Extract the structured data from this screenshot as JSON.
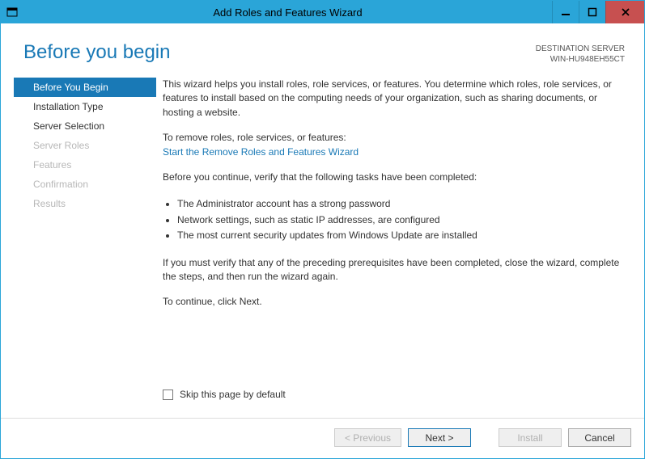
{
  "window": {
    "title": "Add Roles and Features Wizard"
  },
  "header": {
    "page_title": "Before you begin",
    "dest_label": "DESTINATION SERVER",
    "dest_value": "WIN-HU948EH55CT"
  },
  "nav": {
    "items": [
      {
        "label": "Before You Begin",
        "state": "selected"
      },
      {
        "label": "Installation Type",
        "state": "enabled"
      },
      {
        "label": "Server Selection",
        "state": "enabled"
      },
      {
        "label": "Server Roles",
        "state": "disabled"
      },
      {
        "label": "Features",
        "state": "disabled"
      },
      {
        "label": "Confirmation",
        "state": "disabled"
      },
      {
        "label": "Results",
        "state": "disabled"
      }
    ]
  },
  "content": {
    "intro": "This wizard helps you install roles, role services, or features. You determine which roles, role services, or features to install based on the computing needs of your organization, such as sharing documents, or hosting a website.",
    "remove_lead": "To remove roles, role services, or features:",
    "remove_link": "Start the Remove Roles and Features Wizard",
    "verify_lead": "Before you continue, verify that the following tasks have been completed:",
    "bullets": [
      "The Administrator account has a strong password",
      "Network settings, such as static IP addresses, are configured",
      "The most current security updates from Windows Update are installed"
    ],
    "close_note": "If you must verify that any of the preceding prerequisites have been completed, close the wizard, complete the steps, and then run the wizard again.",
    "continue_note": "To continue, click Next.",
    "skip_label": "Skip this page by default"
  },
  "footer": {
    "previous": "< Previous",
    "next": "Next >",
    "install": "Install",
    "cancel": "Cancel"
  }
}
